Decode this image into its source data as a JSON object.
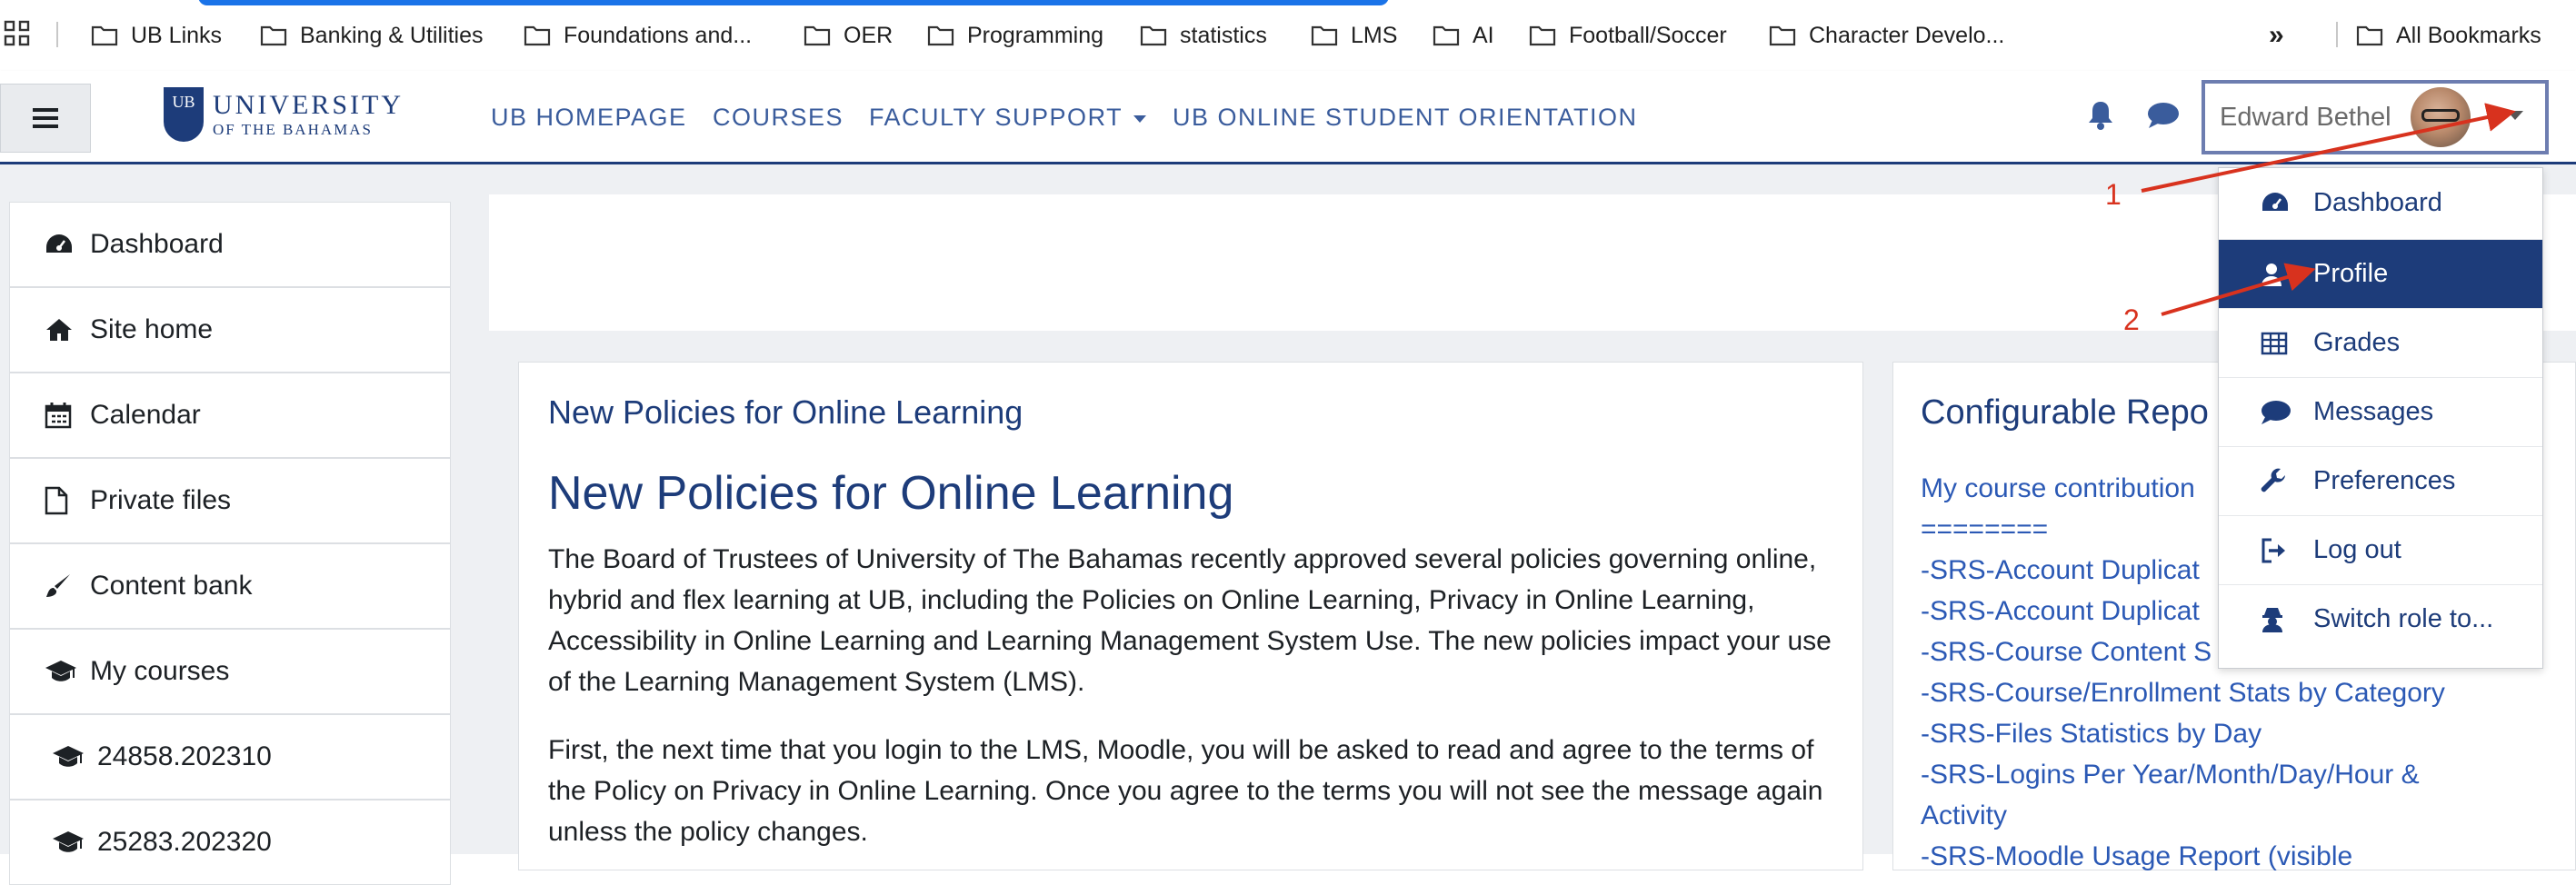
{
  "bookmarks": {
    "items": [
      {
        "label": "UB Links"
      },
      {
        "label": "Banking & Utilities"
      },
      {
        "label": "Foundations and..."
      },
      {
        "label": "OER"
      },
      {
        "label": "Programming"
      },
      {
        "label": "statistics"
      },
      {
        "label": "LMS"
      },
      {
        "label": "AI"
      },
      {
        "label": "Football/Soccer"
      },
      {
        "label": "Character Develo..."
      }
    ],
    "overflow": "»",
    "all_bookmarks": "All Bookmarks"
  },
  "navbar": {
    "logo_line1": "UNIVERSITY",
    "logo_line2": "OF THE BAHAMAS",
    "logo_badge": "UB",
    "links": [
      {
        "label": "UB HOMEPAGE"
      },
      {
        "label": "COURSES"
      },
      {
        "label": "FACULTY SUPPORT"
      },
      {
        "label": "UB ONLINE STUDENT ORIENTATION"
      }
    ],
    "user_name": "Edward Bethel"
  },
  "sidebar": {
    "items": [
      {
        "label": "Dashboard",
        "icon": "dashboard-icon"
      },
      {
        "label": "Site home",
        "icon": "home-icon"
      },
      {
        "label": "Calendar",
        "icon": "calendar-icon"
      },
      {
        "label": "Private files",
        "icon": "file-icon"
      },
      {
        "label": "Content bank",
        "icon": "brush-icon"
      },
      {
        "label": "My courses",
        "icon": "graduation-cap-icon"
      },
      {
        "label": "24858.202310",
        "icon": "graduation-cap-icon"
      },
      {
        "label": "25283.202320",
        "icon": "graduation-cap-icon"
      }
    ]
  },
  "main_card": {
    "title": "New Policies for Online Learning",
    "heading": "New Policies for Online Learning",
    "paragraph1": "The Board of Trustees of University of The Bahamas recently approved several policies governing online, hybrid and flex learning at UB, including the Policies on Online Learning, Privacy in Online Learning, Accessibility in Online Learning and Learning Management System Use. The new policies impact your use of the Learning Management System (LMS).",
    "paragraph2": "First, the next time that you login to the LMS, Moodle, you will be asked to read and agree to the terms of the Policy on Privacy in Online Learning. Once you agree to the terms you will not see the message again unless the policy changes."
  },
  "side_card": {
    "title": "Configurable Repo",
    "lines": [
      "My course contribution",
      "========",
      "-SRS-Account Duplicat",
      "-SRS-Account Duplicat",
      "-SRS-Course Content S",
      "-SRS-Course/Enrollment Stats by Category",
      "-SRS-Files Statistics by Day",
      "-SRS-Logins Per Year/Month/Day/Hour &",
      "Activity",
      "-SRS-Moodle Usage Report (visible"
    ]
  },
  "user_dropdown": {
    "items": [
      {
        "label": "Dashboard",
        "icon": "dashboard-icon"
      },
      {
        "label": "Profile",
        "icon": "user-icon",
        "active": true
      },
      {
        "label": "Grades",
        "icon": "table-icon"
      },
      {
        "label": "Messages",
        "icon": "comment-icon"
      },
      {
        "label": "Preferences",
        "icon": "wrench-icon"
      },
      {
        "label": "Log out",
        "icon": "sign-out-icon"
      },
      {
        "label": "Switch role to...",
        "icon": "user-secret-icon"
      }
    ]
  },
  "annotations": {
    "step1": "1",
    "step2": "2",
    "color": "#d8321e"
  },
  "colors": {
    "brand_navy": "#1d3c7a",
    "nav_link": "#3a5c9c",
    "link_blue": "#2b59b5",
    "page_bg": "#eef0f3"
  }
}
